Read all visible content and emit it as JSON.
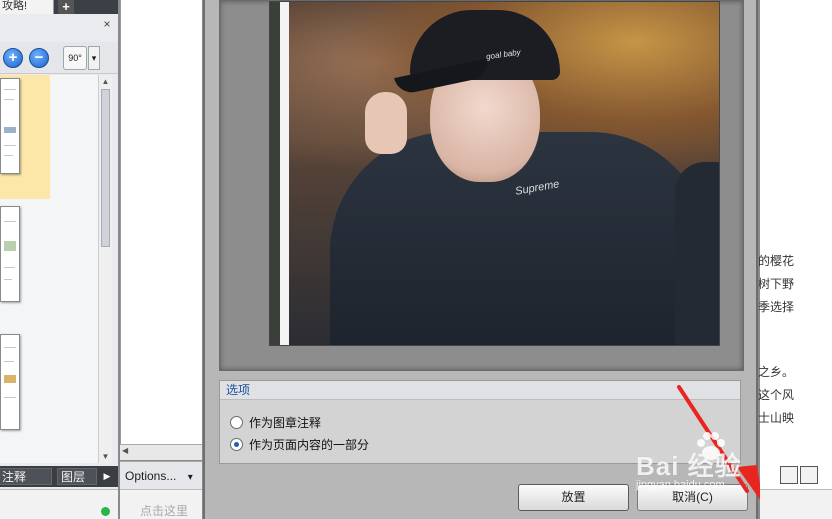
{
  "app": {
    "doc_tab_label": "攻略!",
    "new_tab_symbol": "+",
    "panel_close_symbol": "×",
    "rotation_label": "90°",
    "zoom_in_symbol": "+",
    "zoom_out_symbol": "−",
    "pane_tabs": [
      "注释",
      "图层"
    ],
    "pane_arrow_symbol": "▶",
    "options_label": "Options...",
    "options_arrow_symbol": "▾"
  },
  "dialog": {
    "options_group_title": "选项",
    "radio_options": [
      {
        "label": "作为图章注释",
        "checked": false
      },
      {
        "label": "作为页面内容的一部分",
        "checked": true
      }
    ],
    "place_button": "放置",
    "cancel_button": "取消(C)"
  },
  "photo": {
    "cap_text": "goal baby",
    "jacket_text": "Supreme"
  },
  "article_lines": [
    "的樱花",
    "树下野",
    "季选择",
    "之乡。",
    "这个风",
    "士山映"
  ],
  "watermark": {
    "brand_text": "Bai  经验",
    "url_text": "jingyan.baidu.com"
  },
  "status": {
    "hint_text": "点击这里"
  },
  "colors": {
    "accent_blue": "#1b5fbf",
    "group_title_blue": "#1d4e9c",
    "arrow_red": "#e8261f",
    "status_green": "#28b448"
  }
}
